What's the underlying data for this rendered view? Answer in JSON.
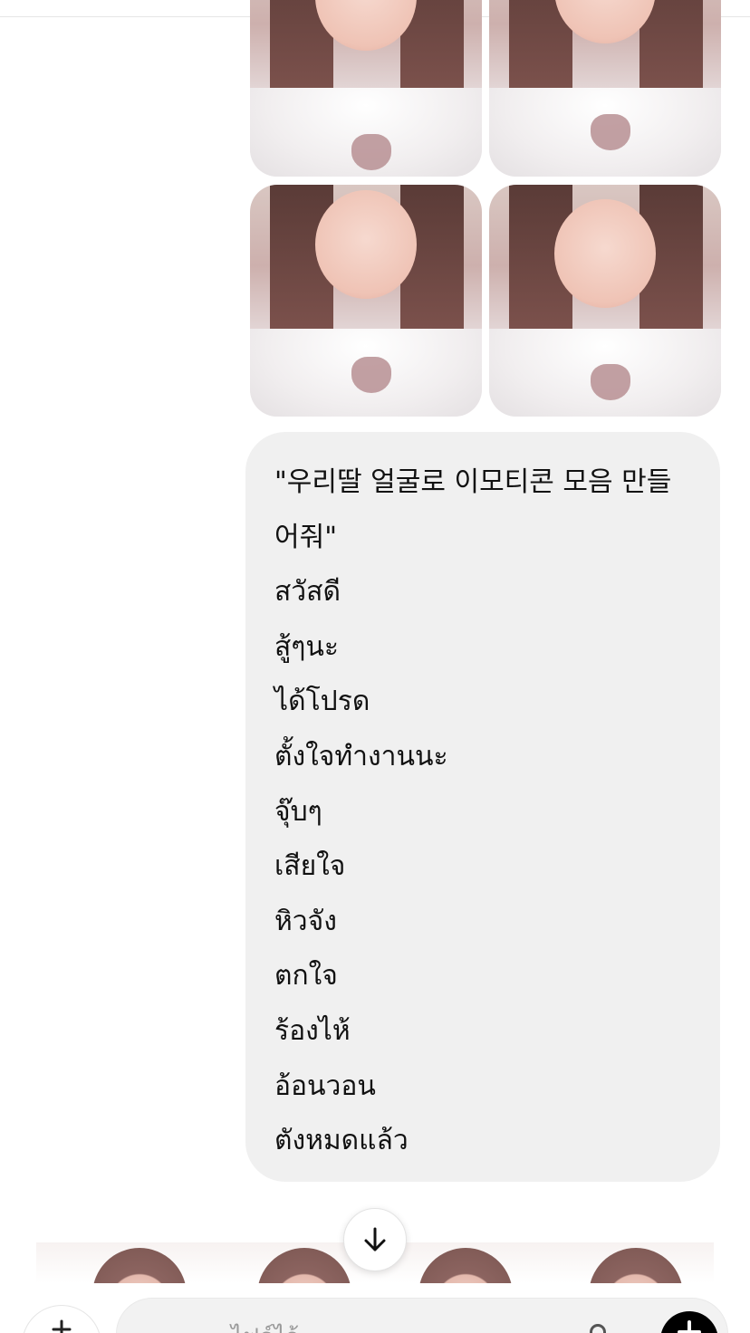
{
  "images": [
    {
      "id": "selfie-1",
      "alt": ""
    },
    {
      "id": "selfie-2",
      "alt": ""
    },
    {
      "id": "selfie-3",
      "alt": ""
    },
    {
      "id": "selfie-4",
      "alt": ""
    }
  ],
  "message": {
    "lines": [
      "\"우리딸 얼굴로 이모티콘 모음 만들어줘\"",
      "สวัสดี",
      "สู้ๆนะ",
      "ได้โปรด",
      "ตั้งใจทำงานนะ",
      "จุ๊บๆ",
      "เสียใจ",
      "หิวจัง",
      "ตกใจ",
      "ร้องไห้",
      "อ้อนวอน",
      "ตังหมดแล้ว"
    ]
  },
  "composer": {
    "placeholder": "ไฟล์ไว้"
  },
  "icons": {
    "scroll": "arrow-down-icon",
    "add": "plus-icon",
    "mic": "mic-icon",
    "send": "send-icon"
  },
  "colors": {
    "bubble": "#f0f0f0",
    "send_button": "#000000"
  }
}
